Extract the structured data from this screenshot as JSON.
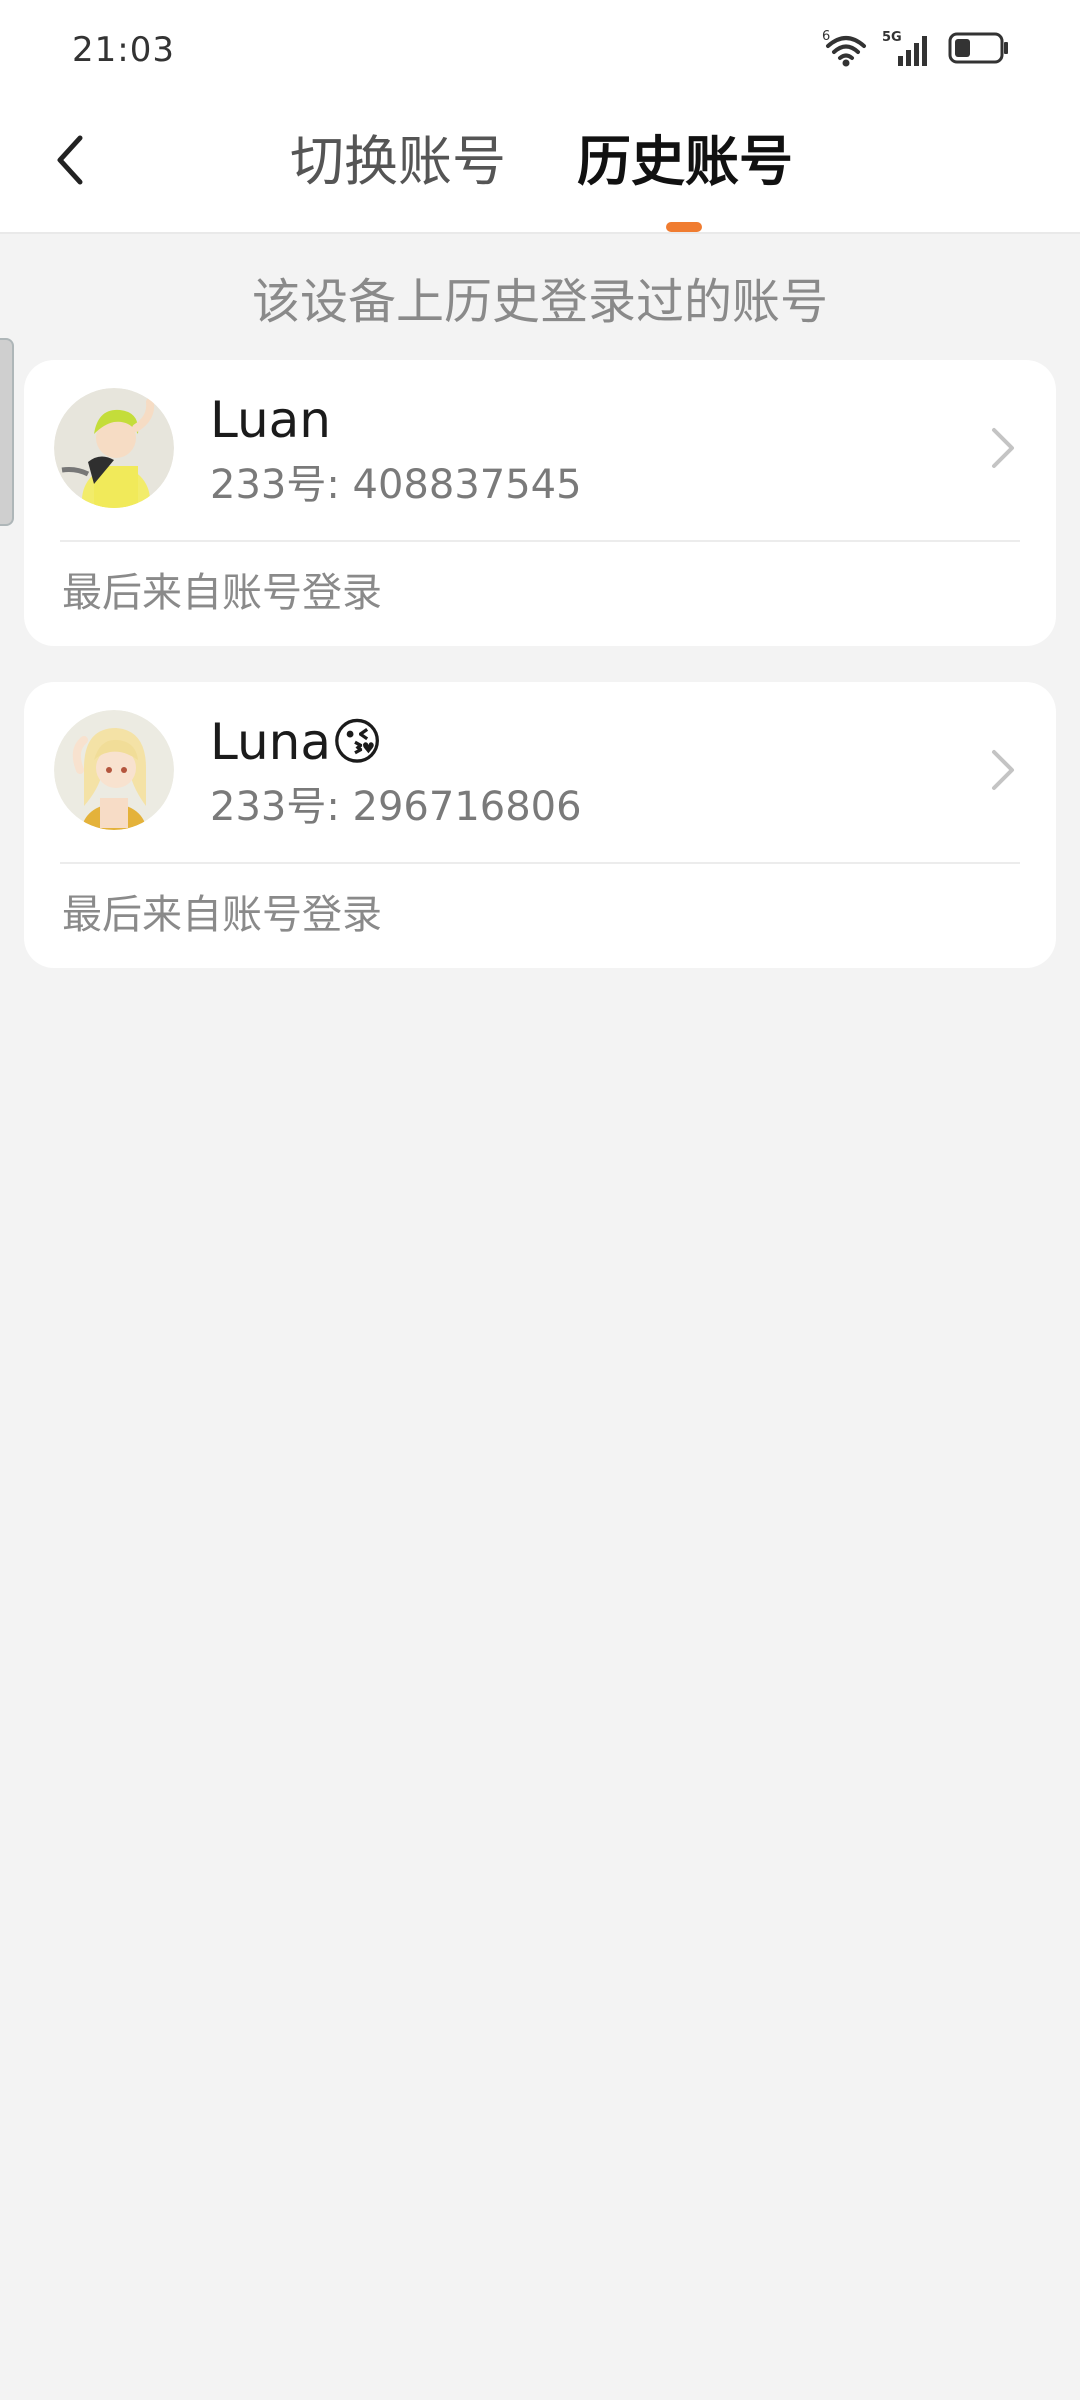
{
  "status_bar": {
    "time": "21:03",
    "wifi_label": "6",
    "cell_label": "5G",
    "battery_level": 0.35
  },
  "header": {
    "tabs": [
      {
        "label": "切换账号",
        "active": false
      },
      {
        "label": "历史账号",
        "active": true
      }
    ],
    "accent_color": "#f07c30"
  },
  "subtitle": "该设备上历史登录过的账号",
  "accounts": [
    {
      "name": "Luan",
      "id_text": "233号: 408837545",
      "login_source": "最后来自账号登录"
    },
    {
      "name": "Luna😘",
      "id_text": "233号: 296716806",
      "login_source": "最后来自账号登录"
    }
  ]
}
